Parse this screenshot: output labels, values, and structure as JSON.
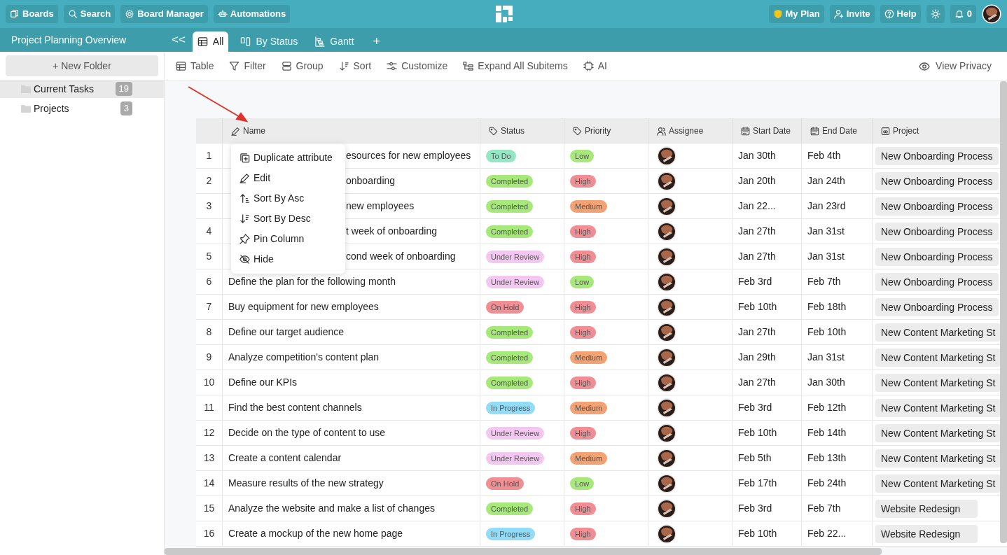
{
  "top_bar": {
    "left_buttons": [
      "Boards",
      "Search",
      "Board Manager",
      "Automations"
    ],
    "right_buttons": [
      "My Plan",
      "Invite",
      "Help",
      "0"
    ]
  },
  "board_title": "Project Planning Overview",
  "collapse_glyph": "<<",
  "tabs": [
    {
      "label": "All",
      "selected": true
    },
    {
      "label": "By Status",
      "selected": false
    },
    {
      "label": "Gantt",
      "selected": false
    }
  ],
  "add_tab_glyph": "+",
  "sidebar": {
    "new_folder": "+ New Folder",
    "items": [
      {
        "label": "Current Tasks",
        "count": "19",
        "selected": true
      },
      {
        "label": "Projects",
        "count": "3",
        "selected": false
      }
    ]
  },
  "toolbar": [
    "Table",
    "Filter",
    "Group",
    "Sort",
    "Customize",
    "Expand All Subitems",
    "AI"
  ],
  "view_privacy": "View Privacy",
  "table": {
    "columns": [
      "Name",
      "Status",
      "Priority",
      "Assignee",
      "Start Date",
      "End Date",
      "Project"
    ],
    "rows": [
      {
        "number": "1",
        "name_visible_end": "esources for new employees",
        "status": {
          "label": "To Do",
          "color": "#95e6c4"
        },
        "priority": {
          "label": "Low",
          "color": "#a6e879"
        },
        "start": "Jan 30th",
        "end": "Feb 4th",
        "project": "New Onboarding Process"
      },
      {
        "number": "2",
        "name_visible_end": "onboarding",
        "status": {
          "label": "Completed",
          "color": "#a6e879"
        },
        "priority": {
          "label": "High",
          "color": "#f08e93"
        },
        "start": "Jan 20th",
        "end": "Jan 24th",
        "project": "New Onboarding Process"
      },
      {
        "number": "3",
        "name_visible_end": "new employees",
        "status": {
          "label": "Completed",
          "color": "#a6e879"
        },
        "priority": {
          "label": "Medium",
          "color": "#f2a273"
        },
        "start": "Jan 22...",
        "end": "Jan 23rd",
        "project": "New Onboarding Process"
      },
      {
        "number": "4",
        "name_visible_end": "t week of onboarding",
        "status": {
          "label": "Completed",
          "color": "#a6e879"
        },
        "priority": {
          "label": "High",
          "color": "#f08e93"
        },
        "start": "Jan 27th",
        "end": "Jan 31st",
        "project": "New Onboarding Process"
      },
      {
        "number": "5",
        "name_visible_end": "cond week of onboarding",
        "status": {
          "label": "Under Review",
          "color": "#f3c8f0"
        },
        "priority": {
          "label": "High",
          "color": "#f08e93"
        },
        "start": "Jan 27th",
        "end": "Jan 31st",
        "project": "New Onboarding Process"
      },
      {
        "number": "6",
        "name_parts": [
          "Define the plan for the following month"
        ],
        "status": {
          "label": "Under Review",
          "color": "#f3c8f0"
        },
        "priority": {
          "label": "Low",
          "color": "#a6e879"
        },
        "start": "Feb 3rd",
        "end": "Feb 7th",
        "project": "New Onboarding Process"
      },
      {
        "number": "7",
        "name_parts": [
          "Buy equipment for new employees"
        ],
        "status": {
          "label": "On Hold",
          "color": "#f08e93"
        },
        "priority": {
          "label": "High",
          "color": "#f08e93"
        },
        "start": "Feb 10th",
        "end": "Feb 18th",
        "project": "New Onboarding Process"
      },
      {
        "number": "8",
        "name_parts": [
          "Define our target audience"
        ],
        "status": {
          "label": "Completed",
          "color": "#a6e879"
        },
        "priority": {
          "label": "High",
          "color": "#f08e93"
        },
        "start": "Jan 27th",
        "end": "Feb 10th",
        "project": "New Content Marketing St"
      },
      {
        "number": "9",
        "name_parts": [
          "Analyze competition's content plan"
        ],
        "status": {
          "label": "Completed",
          "color": "#a6e879"
        },
        "priority": {
          "label": "Medium",
          "color": "#f2a273"
        },
        "start": "Jan 29th",
        "end": "Jan 31st",
        "project": "New Content Marketing St"
      },
      {
        "number": "10",
        "name_parts": [
          "Define our KPIs"
        ],
        "status": {
          "label": "Completed",
          "color": "#a6e879"
        },
        "priority": {
          "label": "High",
          "color": "#f08e93"
        },
        "start": "Jan 27th",
        "end": "Jan 30th",
        "project": "New Content Marketing St"
      },
      {
        "number": "11",
        "name_parts": [
          "Find the best content channels"
        ],
        "status": {
          "label": "In Progress",
          "color": "#93dcf8"
        },
        "priority": {
          "label": "Medium",
          "color": "#f2a273"
        },
        "start": "Feb 3rd",
        "end": "Feb 12th",
        "project": "New Content Marketing St"
      },
      {
        "number": "12",
        "name_parts": [
          "Decide on the type of content to use"
        ],
        "status": {
          "label": "Under Review",
          "color": "#f3c8f0"
        },
        "priority": {
          "label": "High",
          "color": "#f08e93"
        },
        "start": "Feb 10th",
        "end": "Feb 14th",
        "project": "New Content Marketing St"
      },
      {
        "number": "13",
        "name_parts": [
          "Create a content calendar"
        ],
        "status": {
          "label": "Under Review",
          "color": "#f3c8f0"
        },
        "priority": {
          "label": "Medium",
          "color": "#f2a273"
        },
        "start": "Feb 5th",
        "end": "Feb 13th",
        "project": "New Content Marketing St"
      },
      {
        "number": "14",
        "name_parts": [
          "Measure results of the new strategy"
        ],
        "status": {
          "label": "On Hold",
          "color": "#f08e93"
        },
        "priority": {
          "label": "Low",
          "color": "#a6e879"
        },
        "start": "Feb 17th",
        "end": "Feb 24th",
        "project": "New Content Marketing St"
      },
      {
        "number": "15",
        "name_parts": [
          "Analyze the website and make a list of changes"
        ],
        "status": {
          "label": "Completed",
          "color": "#a6e879"
        },
        "priority": {
          "label": "High",
          "color": "#f08e93"
        },
        "start": "Feb 3rd",
        "end": "Feb 7th",
        "project": "Website Redesign"
      },
      {
        "number": "16",
        "name_parts": [
          "Create a mockup of the new home page"
        ],
        "status": {
          "label": "In Progress",
          "color": "#93dcf8"
        },
        "priority": {
          "label": "High",
          "color": "#f08e93"
        },
        "start": "Feb 10th",
        "end": "Feb 22...",
        "project": "Website Redesign"
      }
    ]
  },
  "context_menu": [
    "Duplicate attribute",
    "Edit",
    "Sort By Asc",
    "Sort By Desc",
    "Pin Column",
    "Hide"
  ]
}
